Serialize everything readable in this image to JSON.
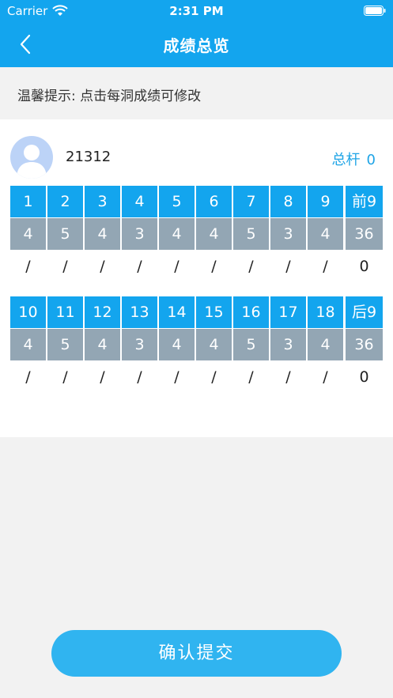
{
  "status_bar": {
    "carrier": "Carrier",
    "time": "2:31 PM"
  },
  "nav": {
    "title": "成绩总览",
    "back_icon": "chevron-left-icon"
  },
  "tip": "温馨提示: 点击每洞成绩可修改",
  "player": {
    "name": "21312",
    "total_label": "总杆",
    "total_value": "0"
  },
  "front_nine": {
    "holes": [
      "1",
      "2",
      "3",
      "4",
      "5",
      "6",
      "7",
      "8",
      "9"
    ],
    "summary_label": "前9",
    "pars": [
      "4",
      "5",
      "4",
      "3",
      "4",
      "4",
      "5",
      "3",
      "4"
    ],
    "par_total": "36",
    "scores": [
      "/",
      "/",
      "/",
      "/",
      "/",
      "/",
      "/",
      "/",
      "/"
    ],
    "score_total": "0"
  },
  "back_nine": {
    "holes": [
      "10",
      "11",
      "12",
      "13",
      "14",
      "15",
      "16",
      "17",
      "18"
    ],
    "summary_label": "后9",
    "pars": [
      "4",
      "5",
      "4",
      "3",
      "4",
      "4",
      "5",
      "3",
      "4"
    ],
    "par_total": "36",
    "scores": [
      "/",
      "/",
      "/",
      "/",
      "/",
      "/",
      "/",
      "/",
      "/"
    ],
    "score_total": "0"
  },
  "submit_label": "确认提交",
  "colors": {
    "primary": "#13a5ee",
    "par_gray": "#93a6b4",
    "button": "#30b4f0"
  }
}
